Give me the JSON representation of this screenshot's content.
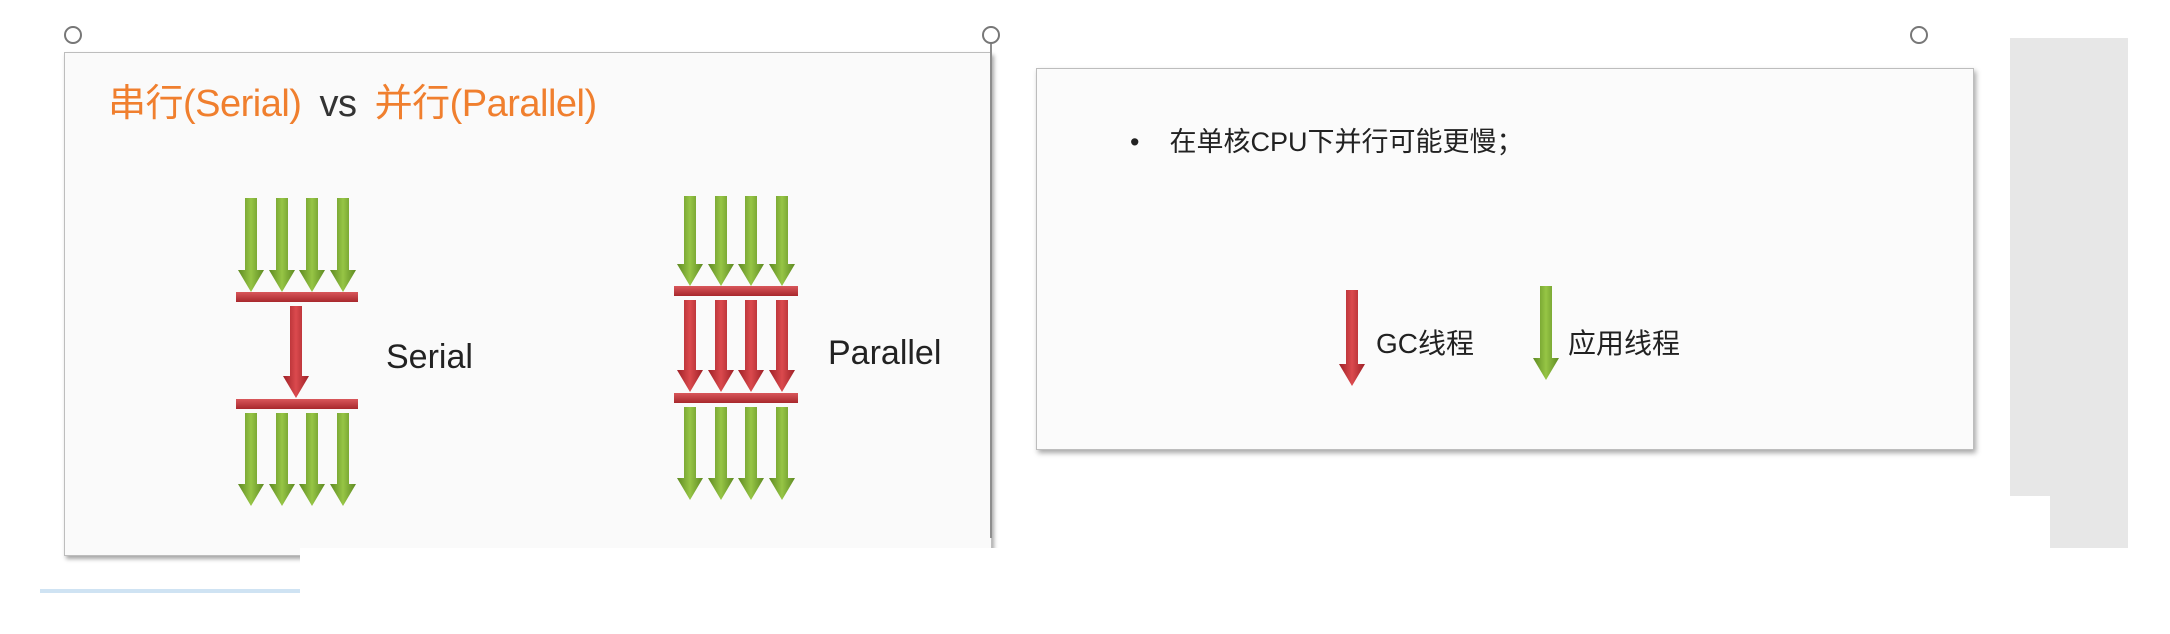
{
  "slide_left": {
    "title_serial": "串行(Serial)",
    "title_vs": "vs",
    "title_parallel": "并行(Parallel)",
    "serial_label": "Serial",
    "parallel_label": "Parallel"
  },
  "slide_right": {
    "bullet_text": "在单核CPU下并行可能更慢；",
    "legend_gc": "GC线程",
    "legend_app": "应用线程"
  },
  "colors": {
    "title_accent": "#f07f2e",
    "gc_thread": "#c8363a",
    "app_thread": "#79a632"
  }
}
